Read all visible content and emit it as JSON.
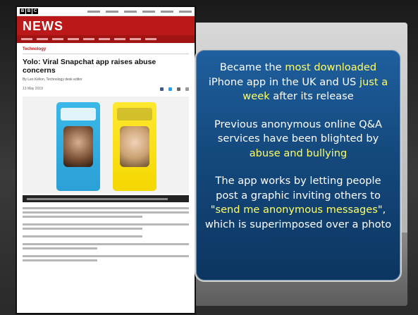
{
  "article": {
    "site_name": "NEWS",
    "bbc_logo_letters": [
      "B",
      "B",
      "C"
    ],
    "section": "Technology",
    "headline": "Yolo: Viral Snapchat app raises abuse concerns",
    "byline": "By Leo Kelion, Technology desk editor",
    "date": "13 May 2019"
  },
  "callout": {
    "p1": {
      "pre": "Became the ",
      "hl1": "most downloaded",
      "mid": " iPhone app in the UK and US ",
      "hl2": "just a week",
      "post": " after its release"
    },
    "p2": {
      "pre": "Previous anonymous online Q&A services have been blighted by ",
      "hl": "abuse and bullying"
    },
    "p3": {
      "pre": "The app works by letting people post a graphic inviting others to \"",
      "hl": "send me anonymous messages",
      "post": "\", which is superimposed over a photo"
    }
  },
  "colors": {
    "bbc_red": "#bb1919",
    "callout_blue": "#1f5f9e",
    "highlight_yellow": "#ffff66"
  }
}
